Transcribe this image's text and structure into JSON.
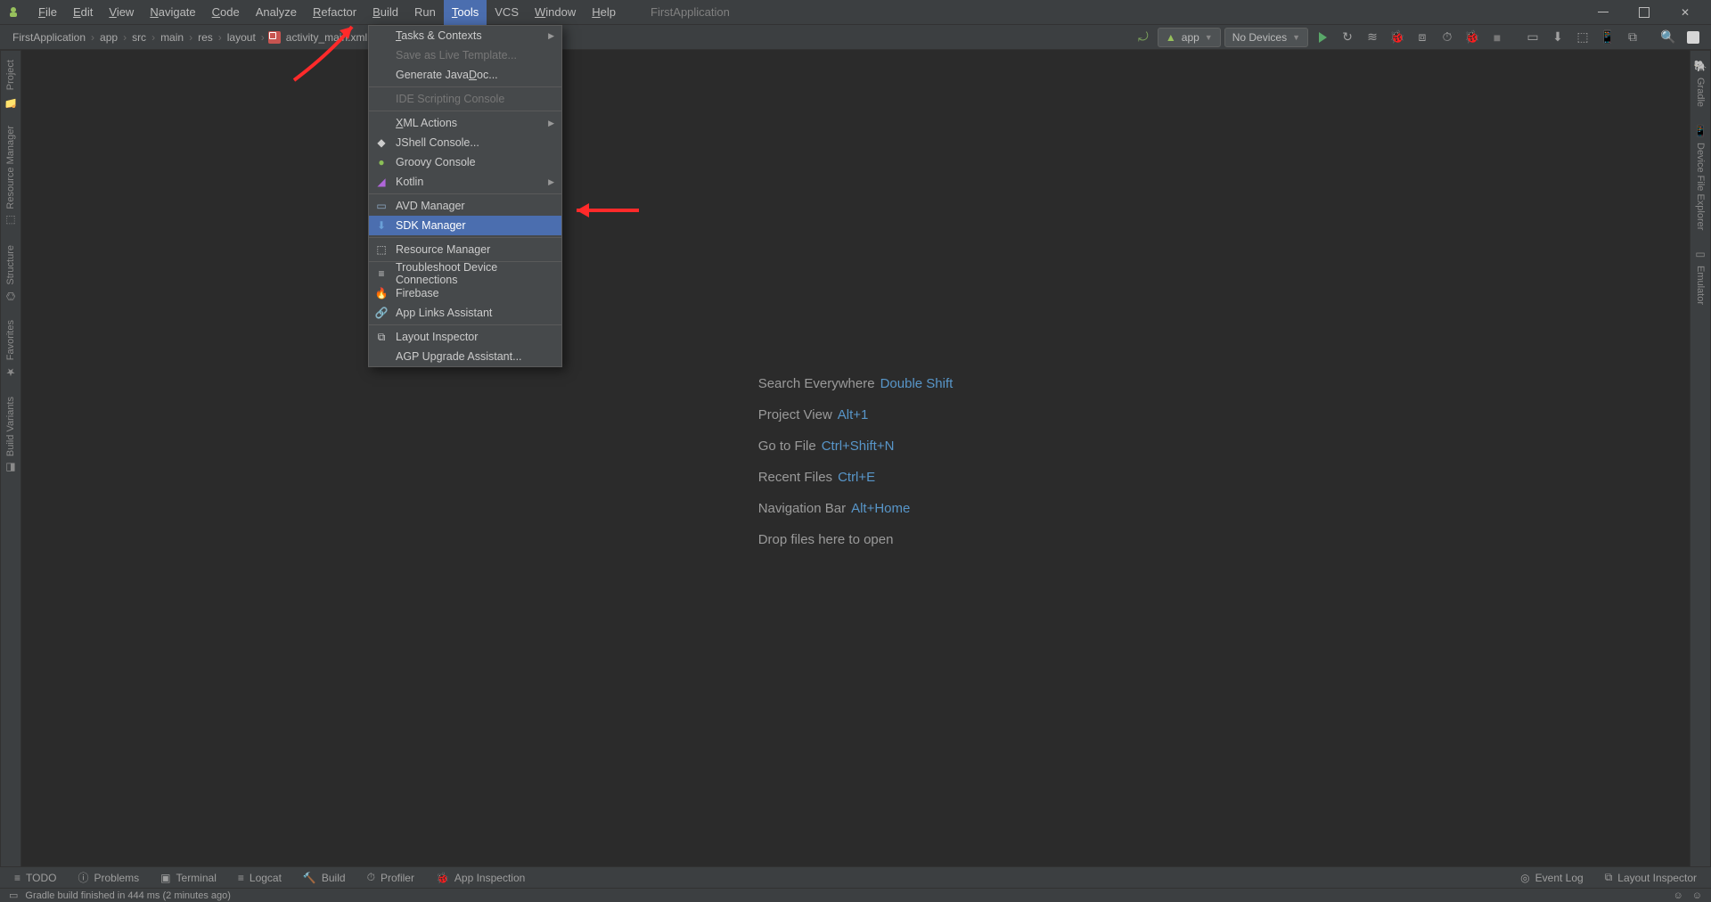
{
  "menubar": {
    "items": [
      {
        "label": "File",
        "mn": "F"
      },
      {
        "label": "Edit",
        "mn": "E"
      },
      {
        "label": "View",
        "mn": "V"
      },
      {
        "label": "Navigate",
        "mn": "N"
      },
      {
        "label": "Code",
        "mn": "C"
      },
      {
        "label": "Analyze",
        "mn": ""
      },
      {
        "label": "Refactor",
        "mn": "R"
      },
      {
        "label": "Build",
        "mn": "B"
      },
      {
        "label": "Run",
        "mn": ""
      },
      {
        "label": "Tools",
        "mn": "T",
        "active": true
      },
      {
        "label": "VCS",
        "mn": ""
      },
      {
        "label": "Window",
        "mn": "W"
      },
      {
        "label": "Help",
        "mn": "H"
      }
    ],
    "title": "FirstApplication"
  },
  "breadcrumbs": [
    "FirstApplication",
    "app",
    "src",
    "main",
    "res",
    "layout",
    "activity_main.xml"
  ],
  "toolbar": {
    "run_config": "app",
    "devices": "No Devices"
  },
  "left_stripe": [
    {
      "icon": "📁",
      "label": "Project"
    },
    {
      "icon": "⬚",
      "label": "Resource Manager"
    },
    {
      "icon": "⌬",
      "label": "Structure"
    },
    {
      "icon": "★",
      "label": "Favorites"
    },
    {
      "icon": "◧",
      "label": "Build Variants"
    }
  ],
  "right_stripe": [
    {
      "icon": "🐘",
      "label": "Gradle"
    },
    {
      "icon": "📱",
      "label": "Device File Explorer"
    },
    {
      "icon": "▭",
      "label": "Emulator"
    }
  ],
  "welcome": [
    {
      "text": "Search Everywhere",
      "shortcut": "Double Shift"
    },
    {
      "text": "Project View",
      "shortcut": "Alt+1"
    },
    {
      "text": "Go to File",
      "shortcut": "Ctrl+Shift+N"
    },
    {
      "text": "Recent Files",
      "shortcut": "Ctrl+E"
    },
    {
      "text": "Navigation Bar",
      "shortcut": "Alt+Home"
    },
    {
      "text": "Drop files here to open",
      "shortcut": ""
    }
  ],
  "tools_menu": [
    {
      "type": "item",
      "label": "Tasks & Contexts",
      "mn": "T",
      "submenu": true
    },
    {
      "type": "item",
      "label": "Save as Live Template...",
      "disabled": true
    },
    {
      "type": "item",
      "label": "Generate JavaDoc...",
      "mn": "D"
    },
    {
      "type": "sep"
    },
    {
      "type": "item",
      "label": "IDE Scripting Console",
      "disabled": true
    },
    {
      "type": "sep"
    },
    {
      "type": "item",
      "label": "XML Actions",
      "mn": "X",
      "submenu": true
    },
    {
      "type": "item",
      "label": "JShell Console...",
      "icon": "◆"
    },
    {
      "type": "item",
      "label": "Groovy Console",
      "icon": "●",
      "iconColor": "#8bbf57"
    },
    {
      "type": "item",
      "label": "Kotlin",
      "icon": "◢",
      "iconColor": "#b066d9",
      "submenu": true
    },
    {
      "type": "sep"
    },
    {
      "type": "item",
      "label": "AVD Manager",
      "icon": "▭",
      "iconColor": "#8da9c4"
    },
    {
      "type": "item",
      "label": "SDK Manager",
      "icon": "⬇",
      "iconColor": "#6aa0d8",
      "highlight": true
    },
    {
      "type": "sep"
    },
    {
      "type": "item",
      "label": "Resource Manager",
      "icon": "⬚"
    },
    {
      "type": "sep"
    },
    {
      "type": "item",
      "label": "Troubleshoot Device Connections",
      "icon": "≡"
    },
    {
      "type": "item",
      "label": "Firebase",
      "icon": "🔥",
      "iconColor": "#f5a623"
    },
    {
      "type": "item",
      "label": "App Links Assistant",
      "icon": "🔗",
      "iconColor": "#5896c9"
    },
    {
      "type": "sep"
    },
    {
      "type": "item",
      "label": "Layout Inspector",
      "icon": "⧉"
    },
    {
      "type": "item",
      "label": "AGP Upgrade Assistant..."
    }
  ],
  "bottom_toolbar": {
    "left": [
      {
        "icon": "≡",
        "label": "TODO"
      },
      {
        "icon": "ⓘ",
        "label": "Problems"
      },
      {
        "icon": "▣",
        "label": "Terminal"
      },
      {
        "icon": "≡",
        "label": "Logcat"
      },
      {
        "icon": "🔨",
        "label": "Build"
      },
      {
        "icon": "⏱",
        "label": "Profiler"
      },
      {
        "icon": "🐞",
        "label": "App Inspection"
      }
    ],
    "right": [
      {
        "icon": "◎",
        "label": "Event Log"
      },
      {
        "icon": "⧉",
        "label": "Layout Inspector"
      }
    ]
  },
  "statusbar": {
    "icon": "▭",
    "message": "Gradle build finished in 444 ms (2 minutes ago)"
  }
}
